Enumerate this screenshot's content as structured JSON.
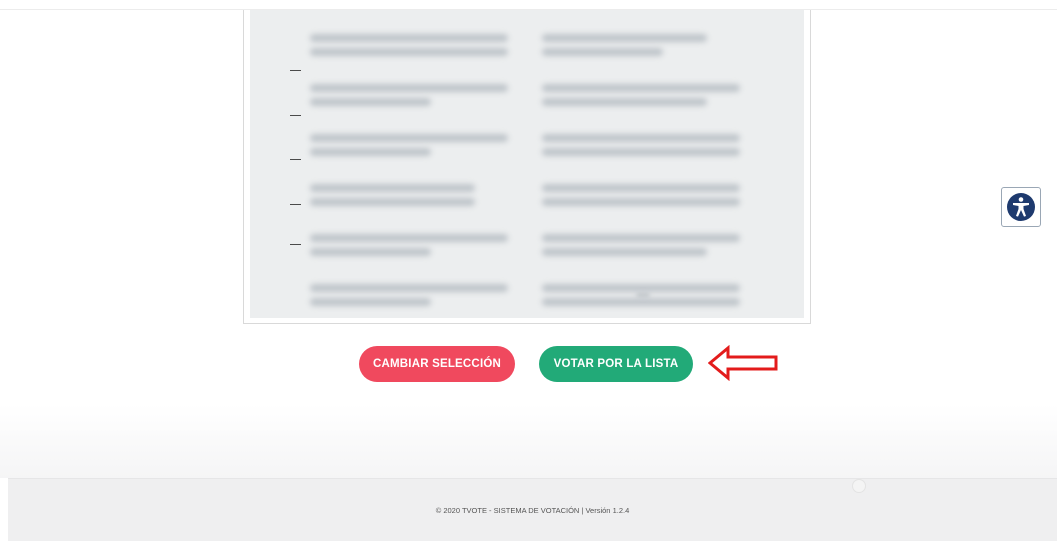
{
  "buttons": {
    "change_label": "CAMBIAR SELECCIÓN",
    "vote_label": "VOTAR POR LA LISTA"
  },
  "footer": {
    "text": "© 2020 TVOTE - SISTEMA DE VOTACIÓN | Versión 1.2.4"
  },
  "colors": {
    "change_button": "#f0495e",
    "vote_button": "#22aa78",
    "arrow": "#e31b1b",
    "accessibility": "#1e3a6e"
  },
  "icons": {
    "accessibility": "accessibility-icon",
    "annotation": "arrow-left-icon"
  }
}
